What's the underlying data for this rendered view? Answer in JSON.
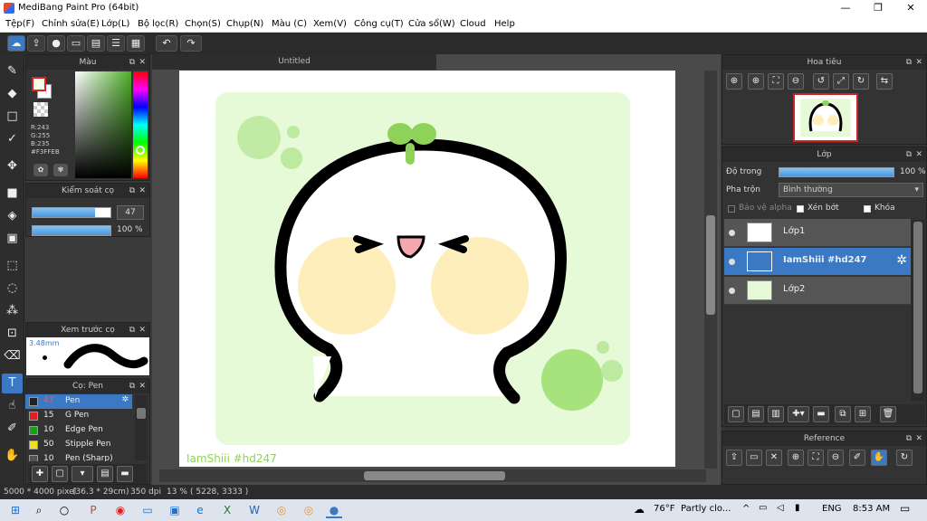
{
  "window": {
    "title": "MediBang Paint Pro (64bit)",
    "minimize": "—",
    "maximize": "❐",
    "close": "✕"
  },
  "menu": [
    "Tệp(F)",
    "Chỉnh sửa(E)",
    "Lớp(L)",
    "Bộ lọc(R)",
    "Chọn(S)",
    "Chụp(N)",
    "Màu (C)",
    "Xem(V)",
    "Công cụ(T)",
    "Cửa sổ(W)",
    "Cloud",
    "Help"
  ],
  "toolbar": {
    "icons": [
      "cloud-icon",
      "upload-icon",
      "chat-icon",
      "comment-icon",
      "page-icon",
      "list-icon",
      "grid-icon",
      "undo-icon",
      "redo-icon"
    ]
  },
  "color_panel": {
    "title": "Màu",
    "values": {
      "r": "R:243",
      "g": "G:255",
      "b": "B:235",
      "hex": "#F3FFEB"
    },
    "fg": "#F3FFEB",
    "bg": "#ffffff",
    "hue_color": "#4caf28"
  },
  "brush_control": {
    "title": "Kiểm soát cọ",
    "size": "47",
    "opacity": "100 %",
    "size_fraction": 0.8,
    "opacity_fraction": 1.0
  },
  "brush_preview": {
    "title": "Xem trước cọ",
    "size": "3.48mm"
  },
  "brush_list": {
    "title": "Cọ: Pen",
    "items": [
      {
        "size": "47",
        "name": "Pen",
        "color": "#222222",
        "selected": true
      },
      {
        "size": "15",
        "name": "G Pen",
        "color": "#e02020",
        "selected": false
      },
      {
        "size": "10",
        "name": "Edge Pen",
        "color": "#18a018",
        "selected": false
      },
      {
        "size": "50",
        "name": "Stipple Pen",
        "color": "#f0e020",
        "selected": false
      },
      {
        "size": "10",
        "name": "Pen (Sharp)",
        "color": "#555555",
        "selected": false
      }
    ]
  },
  "document": {
    "tab": "Untitled",
    "watermark": "IamShiii #hd247",
    "bg_color": "#e7fad8",
    "cheek_color": "#fdeebb",
    "bubble_color": "#a6e37d",
    "sprout_color": "#8fd25a"
  },
  "navigator": {
    "title": "Hoa tiêu"
  },
  "layer_panel": {
    "title": "Lớp",
    "opacity_label": "Độ trong",
    "opacity_value": "100 %",
    "blend_label": "Pha trộn",
    "blend_value": "Bình thường",
    "protect_alpha": "Bảo vệ alpha",
    "clipping": "Xén bớt",
    "lock": "Khóa",
    "layers": [
      {
        "name": "Lớp1",
        "selected": false
      },
      {
        "name": "IamShiii #hd247",
        "selected": true
      },
      {
        "name": "Lớp2",
        "selected": false
      }
    ]
  },
  "reference": {
    "title": "Reference"
  },
  "status": {
    "size": "5000 * 4000 pixel",
    "cm": "(36.3 * 29cm)",
    "dpi": "350 dpi",
    "zoom": "13 %",
    "coords": "( 5228, 3333 )"
  },
  "taskbar": {
    "temp": "76°F",
    "weather": "Partly clo...",
    "lang": "ENG",
    "time": "8:53 AM"
  }
}
